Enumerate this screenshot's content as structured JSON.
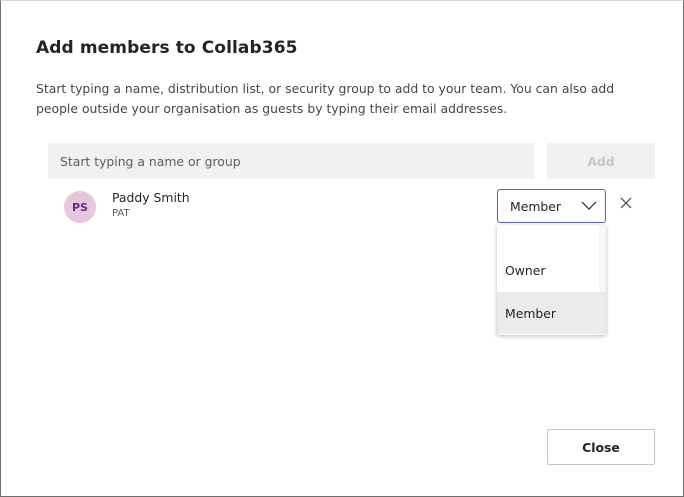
{
  "dialog": {
    "title": "Add members to Collab365",
    "description": "Start typing a name, distribution list, or security group to add to your team. You can also add people outside your organisation as guests by typing their email addresses."
  },
  "search": {
    "value": "",
    "placeholder": "Start typing a name or group"
  },
  "add_button": {
    "label": "Add"
  },
  "member": {
    "initials": "PS",
    "name": "Paddy Smith",
    "subtitle": "PAT",
    "role": "Member"
  },
  "role_menu": {
    "options": [
      "Owner",
      "Member"
    ],
    "selected": "Member"
  },
  "close_button": {
    "label": "Close"
  },
  "icons": {
    "chevron": "chevron-down-icon",
    "remove": "close-icon"
  },
  "colors": {
    "accent": "#5b5fc7",
    "avatar_bg": "#e9c7db",
    "avatar_text": "#5c2e91"
  }
}
